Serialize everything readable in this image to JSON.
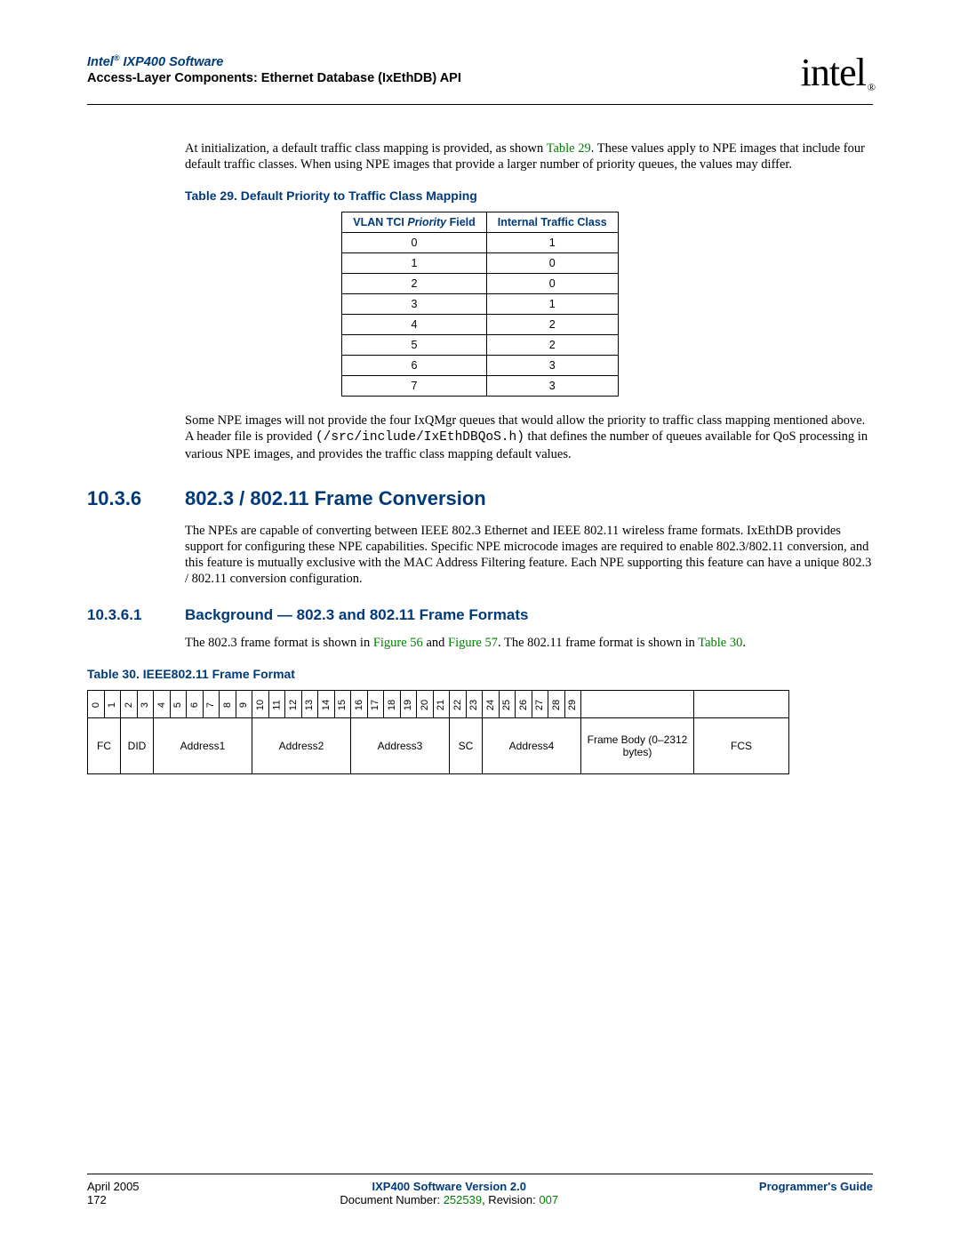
{
  "header": {
    "title_prefix": "Intel",
    "title_reg": "®",
    "title_suffix": " IXP400 Software",
    "subtitle": "Access-Layer Components: Ethernet Database (IxEthDB) API",
    "logo": "intel",
    "logo_sub": "®"
  },
  "para1_a": "At initialization, a default traffic class mapping is provided, as shown ",
  "para1_link": "Table 29",
  "para1_b": ". These values apply to NPE images that include four default traffic classes. When using NPE images that provide a larger number of priority queues, the values may differ.",
  "table29": {
    "caption": "Table 29.  Default Priority to Traffic Class Mapping",
    "h1a": "VLAN TCI ",
    "h1b": "Priority",
    "h1c": " Field",
    "h2": "Internal Traffic Class",
    "rows": [
      {
        "a": "0",
        "b": "1"
      },
      {
        "a": "1",
        "b": "0"
      },
      {
        "a": "2",
        "b": "0"
      },
      {
        "a": "3",
        "b": "1"
      },
      {
        "a": "4",
        "b": "2"
      },
      {
        "a": "5",
        "b": "2"
      },
      {
        "a": "6",
        "b": "3"
      },
      {
        "a": "7",
        "b": "3"
      }
    ]
  },
  "para2_a": "Some NPE images will not provide the four IxQMgr queues that would allow the priority to traffic class mapping mentioned above. A header file is provided ",
  "para2_code": "(/src/include/IxEthDBQoS.h)",
  "para2_b": " that defines the number of queues available for QoS processing in various NPE images, and provides the traffic class mapping default values.",
  "sec": {
    "num": "10.3.6",
    "title": "802.3 / 802.11 Frame Conversion"
  },
  "para3": "The NPEs are capable of converting between IEEE 802.3 Ethernet and IEEE 802.11 wireless frame formats. IxEthDB provides support for configuring these NPE capabilities. Specific NPE microcode images are required to enable 802.3/802.11 conversion, and this feature is mutually exclusive with the MAC Address Filtering feature. Each NPE supporting this feature can have a unique 802.3 / 802.11 conversion configuration.",
  "subsec": {
    "num": "10.3.6.1",
    "title": "Background — 802.3 and 802.11 Frame Formats"
  },
  "para4_a": "The 802.3 frame format is shown in ",
  "para4_l1": "Figure 56",
  "para4_b": " and ",
  "para4_l2": "Figure 57",
  "para4_c": ". The 802.11 frame format is shown in ",
  "para4_l3": "Table 30",
  "para4_d": ".",
  "table30": {
    "caption": "Table 30.  IEEE802.11 Frame Format",
    "bits": [
      "0",
      "1",
      "2",
      "3",
      "4",
      "5",
      "6",
      "7",
      "8",
      "9",
      "10",
      "11",
      "12",
      "13",
      "14",
      "15",
      "16",
      "17",
      "18",
      "19",
      "20",
      "21",
      "22",
      "23",
      "24",
      "25",
      "26",
      "27",
      "28",
      "29"
    ],
    "extra1": "",
    "extra2": "",
    "fields": {
      "fc": "FC",
      "did": "DID",
      "a1": "Address1",
      "a2": "Address2",
      "a3": "Address3",
      "sc": "SC",
      "a4": "Address4",
      "body": "Frame Body (0–2312 bytes)",
      "fcs": "FCS"
    }
  },
  "footer": {
    "date": "April 2005",
    "page": "172",
    "center_bold": "IXP400 Software Version 2.0",
    "doc_a": "Document Number: ",
    "doc_num": "252539",
    "doc_b": ", Revision: ",
    "doc_rev": "007",
    "right": "Programmer's Guide"
  }
}
